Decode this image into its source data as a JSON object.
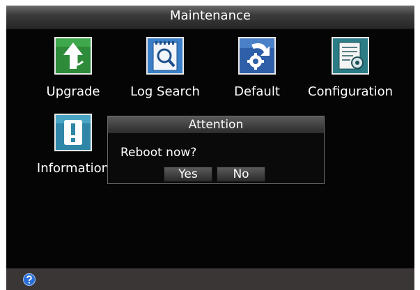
{
  "window": {
    "title": "Maintenance"
  },
  "tiles": [
    {
      "label": "Upgrade",
      "icon": "upgrade-arrow-icon",
      "color": "#2e8b3a"
    },
    {
      "label": "Log Search",
      "icon": "log-search-icon",
      "color": "#3a7fc8"
    },
    {
      "label": "Default",
      "icon": "default-restore-icon",
      "color": "#2f5fa8"
    },
    {
      "label": "Configuration",
      "icon": "configuration-icon",
      "color": "#2c7c86"
    },
    {
      "label": "Information",
      "icon": "information-icon",
      "color": "#2f86a6"
    }
  ],
  "dialog": {
    "title": "Attention",
    "message": "Reboot now?",
    "yes_label": "Yes",
    "no_label": "No"
  },
  "statusbar": {
    "help_icon": "help-icon"
  }
}
